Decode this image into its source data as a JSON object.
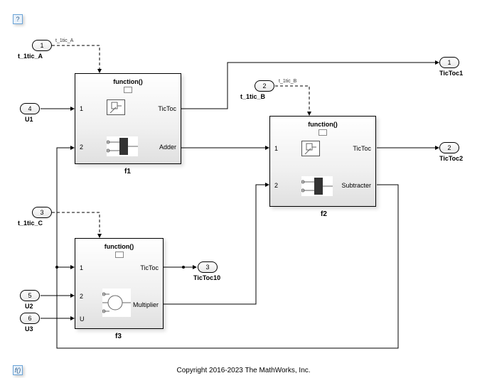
{
  "badges": {
    "help": "?",
    "func": "f()"
  },
  "copyright": "Copyright 2016-2023 The MathWorks, Inc.",
  "inports": {
    "t1tic_A": {
      "num": "1",
      "label": "t_1tic_A",
      "tiny": "t_1tic_A"
    },
    "t1tic_B": {
      "num": "2",
      "label": "t_1tic_B",
      "tiny": "t_1tic_B"
    },
    "t1tic_C": {
      "num": "3",
      "label": "t_1tic_C"
    },
    "U1": {
      "num": "4",
      "label": "U1"
    },
    "U2": {
      "num": "5",
      "label": "U2"
    },
    "U3": {
      "num": "6",
      "label": "U3"
    }
  },
  "outports": {
    "TicToc1": {
      "num": "1",
      "label": "TicToc1"
    },
    "TicToc2": {
      "num": "2",
      "label": "TicToc2"
    },
    "TicToc10": {
      "num": "3",
      "label": "TicToc10"
    }
  },
  "subsystems": {
    "f1": {
      "name": "f1",
      "fn": "function()",
      "in": [
        "1",
        "2"
      ],
      "out": [
        "TicToc",
        "Adder"
      ]
    },
    "f2": {
      "name": "f2",
      "fn": "function()",
      "in": [
        "1",
        "2"
      ],
      "out": [
        "TicToc",
        "Subtracter"
      ]
    },
    "f3": {
      "name": "f3",
      "fn": "function()",
      "in": [
        "1",
        "2",
        "U"
      ],
      "out": [
        "TicToc",
        "Multiplier"
      ]
    }
  }
}
